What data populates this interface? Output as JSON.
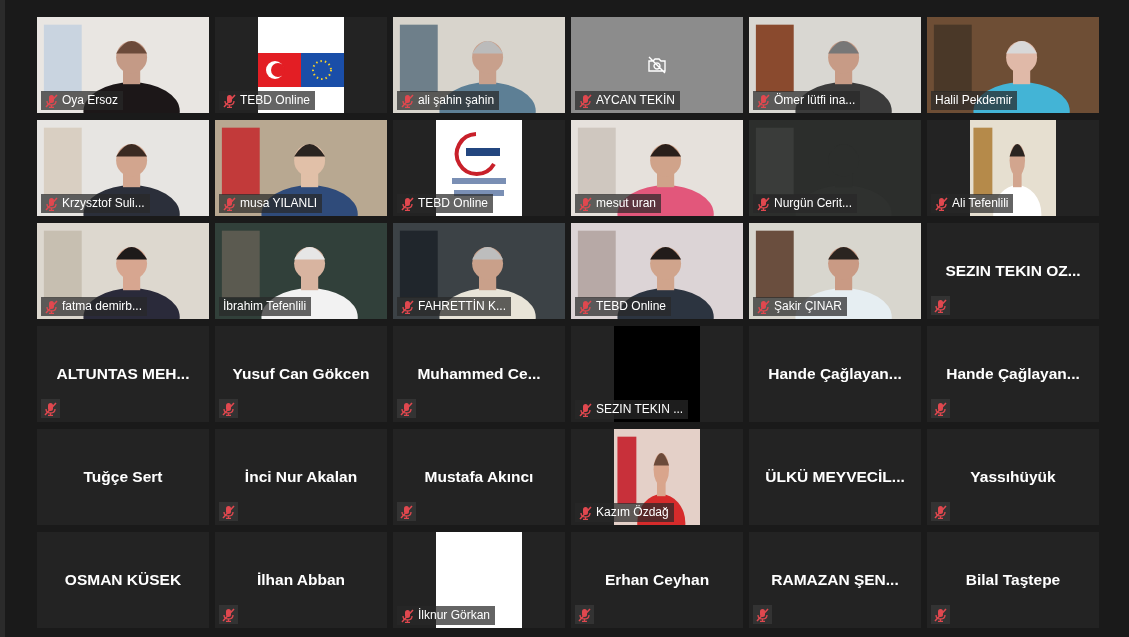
{
  "tiles": [
    {
      "kind": "video",
      "name": "Oya Ersoz",
      "muted": true
    },
    {
      "kind": "avatar",
      "name": "TEBD Online",
      "muted": true
    },
    {
      "kind": "video",
      "name": "ali şahin şahin",
      "muted": true
    },
    {
      "kind": "camera-off",
      "name": "AYCAN TEKİN",
      "muted": true
    },
    {
      "kind": "video",
      "name": "Ömer lütfi ina...",
      "muted": true
    },
    {
      "kind": "video",
      "name": "Halil Pekdemir",
      "muted": false
    },
    {
      "kind": "video",
      "name": "Krzysztof Suli...",
      "muted": true
    },
    {
      "kind": "video",
      "name": "musa YILANLI",
      "muted": true
    },
    {
      "kind": "avatar",
      "name": "TEBD Online",
      "muted": true
    },
    {
      "kind": "video",
      "name": "mesut uran",
      "muted": true
    },
    {
      "kind": "video",
      "name": "Nurgün Cerit...",
      "muted": true
    },
    {
      "kind": "avatar",
      "name": "Ali Tefenlili",
      "muted": true
    },
    {
      "kind": "video",
      "name": "fatma demirb...",
      "muted": true
    },
    {
      "kind": "video",
      "name": "İbrahim Tefenlili",
      "muted": false
    },
    {
      "kind": "video",
      "name": "FAHRETTİN K...",
      "muted": true
    },
    {
      "kind": "video",
      "name": "TEBD Online",
      "muted": true
    },
    {
      "kind": "video",
      "name": "Şakir ÇINAR",
      "muted": true
    },
    {
      "kind": "name",
      "name": "SEZIN TEKIN OZ...",
      "muted": true
    },
    {
      "kind": "name",
      "name": "ALTUNTAS MEH...",
      "muted": true
    },
    {
      "kind": "name",
      "name": "Yusuf Can Gökcen",
      "muted": true
    },
    {
      "kind": "name",
      "name": "Muhammed Ce...",
      "muted": true
    },
    {
      "kind": "blank-avatar",
      "name": "SEZIN TEKIN ...",
      "muted": true,
      "color": "#000000"
    },
    {
      "kind": "name",
      "name": "Hande Çağlayan...",
      "muted": false
    },
    {
      "kind": "name",
      "name": "Hande Çağlayan...",
      "muted": true
    },
    {
      "kind": "name",
      "name": "Tuğçe Sert",
      "muted": false
    },
    {
      "kind": "name",
      "name": "İnci Nur Akalan",
      "muted": true
    },
    {
      "kind": "name",
      "name": "Mustafa Akıncı",
      "muted": true
    },
    {
      "kind": "avatar",
      "name": "Kazım Özdağ",
      "muted": true
    },
    {
      "kind": "name",
      "name": "ÜLKÜ MEYVECİL...",
      "muted": false
    },
    {
      "kind": "name",
      "name": "Yassıhüyük",
      "muted": true
    },
    {
      "kind": "name",
      "name": "OSMAN KÜSEK",
      "muted": false
    },
    {
      "kind": "name",
      "name": "İlhan Abban",
      "muted": true
    },
    {
      "kind": "blank-avatar",
      "name": "İlknur Görkan",
      "muted": true,
      "color": "#ffffff"
    },
    {
      "kind": "name",
      "name": "Erhan Ceyhan",
      "muted": true
    },
    {
      "kind": "name",
      "name": "RAMAZAN ŞEN...",
      "muted": true
    },
    {
      "kind": "name",
      "name": "Bilal Taştepe",
      "muted": true
    }
  ]
}
